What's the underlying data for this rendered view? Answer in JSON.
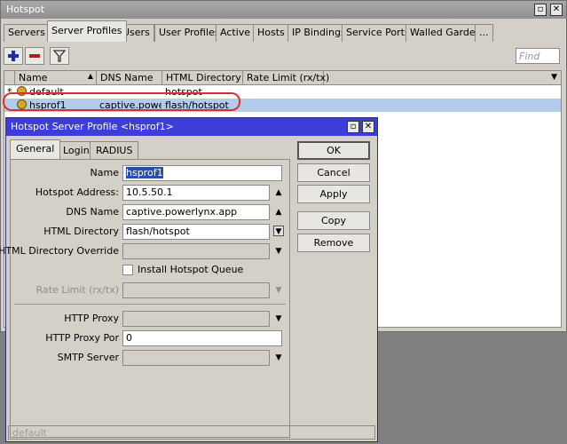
{
  "window": {
    "title": "Hotspot"
  },
  "tabs": [
    "Servers",
    "Server Profiles",
    "Users",
    "User Profiles",
    "Active",
    "Hosts",
    "IP Bindings",
    "Service Ports",
    "Walled Garden",
    "..."
  ],
  "toolbar": {
    "find_placeholder": "Find"
  },
  "table": {
    "columns": [
      "Name",
      "DNS Name",
      "HTML Directory",
      "Rate Limit (rx/tx)"
    ],
    "rows": [
      {
        "marker": "*",
        "name": "default",
        "dns": "",
        "dir": "hotspot",
        "rate": ""
      },
      {
        "marker": "",
        "name": "hsprof1",
        "dns": "captive.powe...",
        "dir": "flash/hotspot",
        "rate": ""
      }
    ]
  },
  "dialog": {
    "title": "Hotspot Server Profile <hsprof1>",
    "tabs": [
      "General",
      "Login",
      "RADIUS"
    ],
    "fields": {
      "name_label": "Name",
      "name_value": "hsprof1",
      "address_label": "Hotspot Address:",
      "address_value": "10.5.50.1",
      "dns_label": "DNS Name",
      "dns_value": "captive.powerlynx.app",
      "dir_label": "HTML Directory",
      "dir_value": "flash/hotspot",
      "override_label": "HTML Directory Override",
      "override_value": "",
      "queue_label": "Install Hotspot Queue",
      "rate_label": "Rate Limit (rx/tx)",
      "rate_value": "",
      "proxy_label": "HTTP Proxy",
      "proxy_value": "",
      "proxyport_label": "HTTP Proxy Por",
      "proxyport_value": "0",
      "smtp_label": "SMTP Server",
      "smtp_value": ""
    },
    "buttons": {
      "ok": "OK",
      "cancel": "Cancel",
      "apply": "Apply",
      "copy": "Copy",
      "remove": "Remove"
    },
    "status": "default"
  },
  "colors": {
    "selected_row": "#b4cbe9",
    "highlight_ring": "#d9302b",
    "dialog_title": "#3d3dd9"
  }
}
